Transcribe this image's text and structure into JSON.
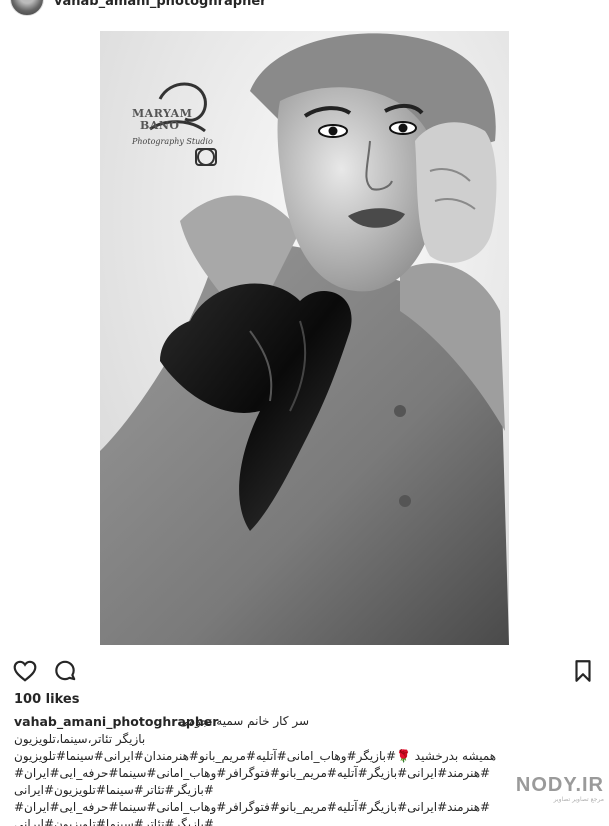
{
  "header": {
    "username": "vahab_amani_photoghrapher"
  },
  "watermark": {
    "line1": "MARYAM",
    "line2": "BANO",
    "line3": "Photography Studio"
  },
  "actions": {
    "like": "heart-icon",
    "comment": "comment-icon",
    "save": "bookmark-icon"
  },
  "likes": {
    "label": "100 likes"
  },
  "caption": {
    "username": "vahab_amani_photoghrapher",
    "text": "سر کار خانم سمیه نجومی",
    "lines": [
      "بازیگر تئاتر،سینما،تلویزیون",
      "همیشه بدرخشید 🌹#بازیگر#وهاب_امانی#آتلیه#مریم_بانو#هنرمندان#ایرانی#سینما#تلویزیون",
      "#هنرمند#ایرانی#بازیگر#آتلیه#مریم_بانو#فتوگرافر#وهاب_امانی#سینما#حرفه_ایی#ایران#",
      "#بازیگر#تئاتر#سینما#تلویزیون#ایرانی",
      "#هنرمند#ایرانی#بازیگر#آتلیه#مریم_بانو#فتوگرافر#وهاب_امانی#سینما#حرفه_ایی#ایران#",
      "#بازیگر#تئاتر#سینما#تلویزیون#ایرانی"
    ]
  },
  "site_watermark": {
    "main": "NODY.IR",
    "sub": "مرجع تصاویر تصاویر"
  }
}
